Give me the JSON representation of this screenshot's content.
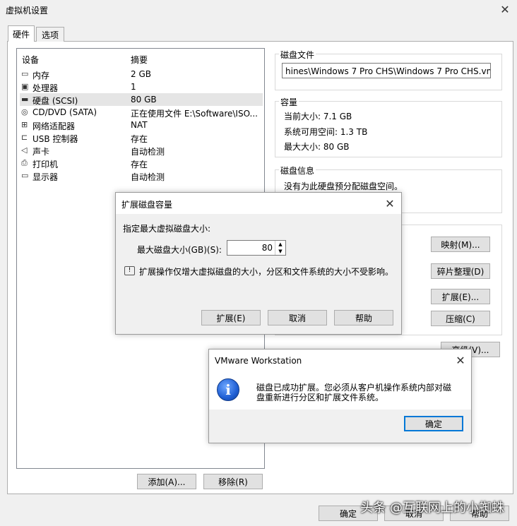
{
  "window": {
    "title": "虚拟机设置",
    "close_label": "✕"
  },
  "tabs": [
    {
      "label": "硬件"
    },
    {
      "label": "选项"
    }
  ],
  "device_list": {
    "col_device": "设备",
    "col_summary": "摘要",
    "rows": [
      {
        "name": "内存",
        "summary": "2 GB",
        "icon": "▭"
      },
      {
        "name": "处理器",
        "summary": "1",
        "icon": "▣"
      },
      {
        "name": "硬盘 (SCSI)",
        "summary": "80 GB",
        "icon": "▬"
      },
      {
        "name": "CD/DVD (SATA)",
        "summary": "正在使用文件 E:\\Software\\ISO...",
        "icon": "◎"
      },
      {
        "name": "网络适配器",
        "summary": "NAT",
        "icon": "⊞"
      },
      {
        "name": "USB 控制器",
        "summary": "存在",
        "icon": "⊏"
      },
      {
        "name": "声卡",
        "summary": "自动检测",
        "icon": "◁"
      },
      {
        "name": "打印机",
        "summary": "存在",
        "icon": "⎙"
      },
      {
        "name": "显示器",
        "summary": "自动检测",
        "icon": "▭"
      }
    ]
  },
  "buttons_bottom": {
    "add": "添加(A)...",
    "remove": "移除(R)"
  },
  "disk_file": {
    "title": "磁盘文件",
    "value": "hines\\Windows 7 Pro CHS\\Windows 7 Pro CHS.vmdk"
  },
  "capacity": {
    "title": "容量",
    "current": "当前大小: 7.1 GB",
    "available": "系统可用空间: 1.3 TB",
    "max": "最大大小: 80 GB"
  },
  "disk_info": {
    "title": "磁盘信息",
    "text": "没有为此硬盘预分配磁盘空间。"
  },
  "utility_buttons": {
    "map": "映射(M)...",
    "defrag": "碎片整理(D)",
    "expand": "扩展(E)...",
    "compact": "压缩(C)",
    "advanced": "高级(V)..."
  },
  "main_buttons": {
    "ok": "确定",
    "cancel": "取消",
    "help": "帮助"
  },
  "expand_dialog": {
    "title": "扩展磁盘容量",
    "prompt": "指定最大虚拟磁盘大小:",
    "field_label": "最大磁盘大小(GB)(S):",
    "field_value": "80",
    "note": "扩展操作仅增大虚拟磁盘的大小，分区和文件系统的大小不受影响。",
    "btn_expand": "扩展(E)",
    "btn_cancel": "取消",
    "btn_help": "帮助"
  },
  "message_box": {
    "title": "VMware Workstation",
    "text_line1": "磁盘已成功扩展。您必须从客户机操作系统内部对磁",
    "text_line2": "盘重新进行分区和扩展文件系统。",
    "ok": "确定"
  },
  "watermark": "头条 @互联网上的小蜘蛛"
}
